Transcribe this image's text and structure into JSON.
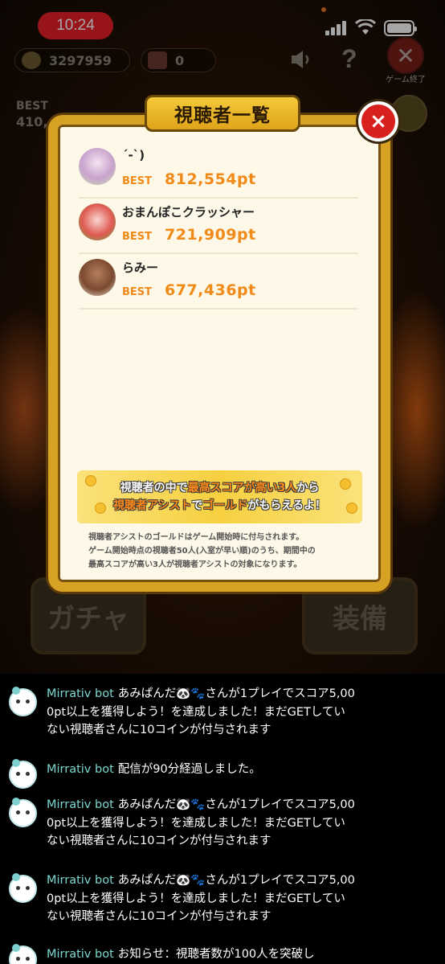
{
  "status_bar": {
    "time": "10:24"
  },
  "hud": {
    "coins": "3297959",
    "gifts": "0",
    "end_game_label": "ゲーム終了",
    "best_label": "BEST",
    "best_value_partial": "410,"
  },
  "background_buttons": {
    "gacha": "ガチャ",
    "equip": "装備"
  },
  "modal": {
    "title": "視聴者一覧",
    "close": "×",
    "viewers": [
      {
        "name": "´-`)",
        "best_label": "BEST",
        "score": "812,554pt"
      },
      {
        "name": "おまんぽこクラッシャー",
        "best_label": "BEST",
        "score": "721,909pt"
      },
      {
        "name": "らみー",
        "best_label": "BEST",
        "score": "677,436pt"
      }
    ],
    "banner": {
      "l1_a": "視聴者の中で",
      "l1_b": "最高スコアが高い3人",
      "l1_c": "から",
      "l2_a": "視聴者アシスト",
      "l2_b": "で",
      "l2_c": "ゴールド",
      "l2_d": "がもらえるよ！"
    },
    "note_lines": [
      "視聴者アシストのゴールドはゲーム開始時に付与されます。",
      "ゲーム開始時点の視聴者50人(入室が早い順)のうち、期間中の",
      "最高スコアが高い3人が視聴者アシストの対象になります。"
    ]
  },
  "chat": [
    {
      "author": "Mirrativ bot",
      "text": "あみぱんだ🐼🐾さんが1プレイでスコア5,000pt以上を獲得しよう！を達成しました！まだGETしていない視聴者さんに10コインが付与されます"
    },
    {
      "author": "Mirrativ bot",
      "text": "配信が90分経過しました。"
    },
    {
      "author": "Mirrativ bot",
      "text": "あみぱんだ🐼🐾さんが1プレイでスコア5,000pt以上を獲得しよう！を達成しました！まだGETしていない視聴者さんに10コインが付与されます"
    },
    {
      "author": "Mirrativ bot",
      "text": "あみぱんだ🐼🐾さんが1プレイでスコア5,000pt以上を獲得しよう！を達成しました！まだGETしていない視聴者さんに10コインが付与されます"
    },
    {
      "author": "Mirrativ bot",
      "text": "お知らせ：視聴者数が100人を突破し"
    }
  ]
}
